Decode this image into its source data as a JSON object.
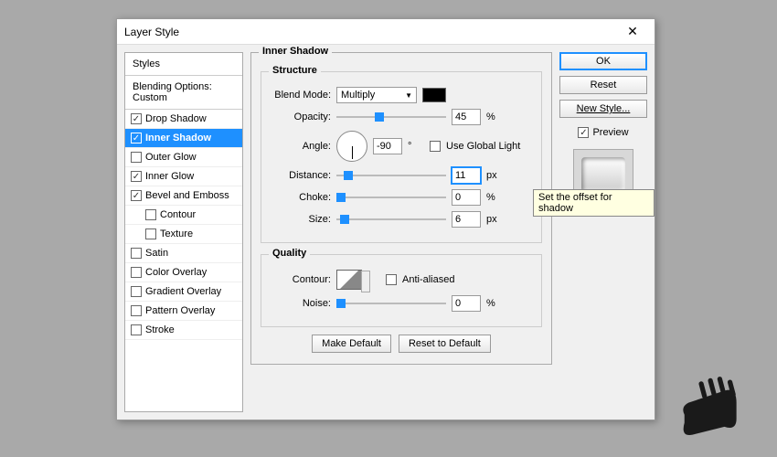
{
  "dialog": {
    "title": "Layer Style"
  },
  "styles": {
    "header": "Styles",
    "blending": "Blending Options: Custom",
    "items": [
      {
        "label": "Drop Shadow",
        "checked": true
      },
      {
        "label": "Inner Shadow",
        "checked": true,
        "selected": true
      },
      {
        "label": "Outer Glow",
        "checked": false
      },
      {
        "label": "Inner Glow",
        "checked": true
      },
      {
        "label": "Bevel and Emboss",
        "checked": true
      },
      {
        "label": "Contour",
        "checked": false,
        "indent": true
      },
      {
        "label": "Texture",
        "checked": false,
        "indent": true
      },
      {
        "label": "Satin",
        "checked": false
      },
      {
        "label": "Color Overlay",
        "checked": false
      },
      {
        "label": "Gradient Overlay",
        "checked": false
      },
      {
        "label": "Pattern Overlay",
        "checked": false
      },
      {
        "label": "Stroke",
        "checked": false
      }
    ]
  },
  "panel": {
    "title": "Inner Shadow",
    "structure": {
      "legend": "Structure",
      "blendMode": {
        "label": "Blend Mode:",
        "value": "Multiply"
      },
      "opacity": {
        "label": "Opacity:",
        "value": "45",
        "unit": "%",
        "thumb": 42
      },
      "angle": {
        "label": "Angle:",
        "value": "-90",
        "unit": "°",
        "globalLabel": "Use Global Light",
        "globalChecked": false
      },
      "distance": {
        "label": "Distance:",
        "value": "11",
        "unit": "px",
        "thumb": 8
      },
      "choke": {
        "label": "Choke:",
        "value": "0",
        "unit": "%",
        "thumb": 0
      },
      "size": {
        "label": "Size:",
        "value": "6",
        "unit": "px",
        "thumb": 4
      }
    },
    "quality": {
      "legend": "Quality",
      "contour": {
        "label": "Contour:",
        "antiLabel": "Anti-aliased",
        "antiChecked": false
      },
      "noise": {
        "label": "Noise:",
        "value": "0",
        "unit": "%",
        "thumb": 0
      }
    },
    "buttons": {
      "makeDefault": "Make Default",
      "resetDefault": "Reset to Default"
    }
  },
  "right": {
    "ok": "OK",
    "reset": "Reset",
    "newStyle": "New Style...",
    "preview": "Preview",
    "previewChecked": true
  },
  "tooltip": "Set the offset for shadow"
}
